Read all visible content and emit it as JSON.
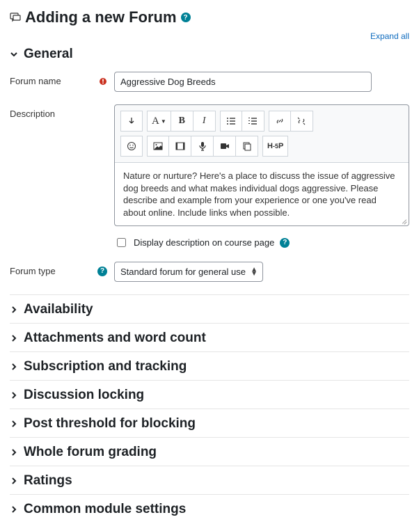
{
  "page": {
    "title": "Adding a new Forum",
    "expand_all": "Expand all"
  },
  "general": {
    "title": "General",
    "forum_name_label": "Forum name",
    "forum_name_value": "Aggressive Dog Breeds",
    "description_label": "Description",
    "description_value": "Nature or nurture?  Here's a place to discuss the issue of aggressive dog breeds and what makes individual dogs aggressive. Please describe and example from your experience or one you've read about online. Include links when possible.",
    "display_on_course_label": "Display description on course page",
    "forum_type_label": "Forum type",
    "forum_type_value": "Standard forum for general use"
  },
  "toolbar": {
    "toggle": "↓",
    "font_style": "A",
    "bold": "B",
    "italic": "I",
    "h5p": "H5P"
  },
  "sections": [
    "Availability",
    "Attachments and word count",
    "Subscription and tracking",
    "Discussion locking",
    "Post threshold for blocking",
    "Whole forum grading",
    "Ratings",
    "Common module settings"
  ]
}
